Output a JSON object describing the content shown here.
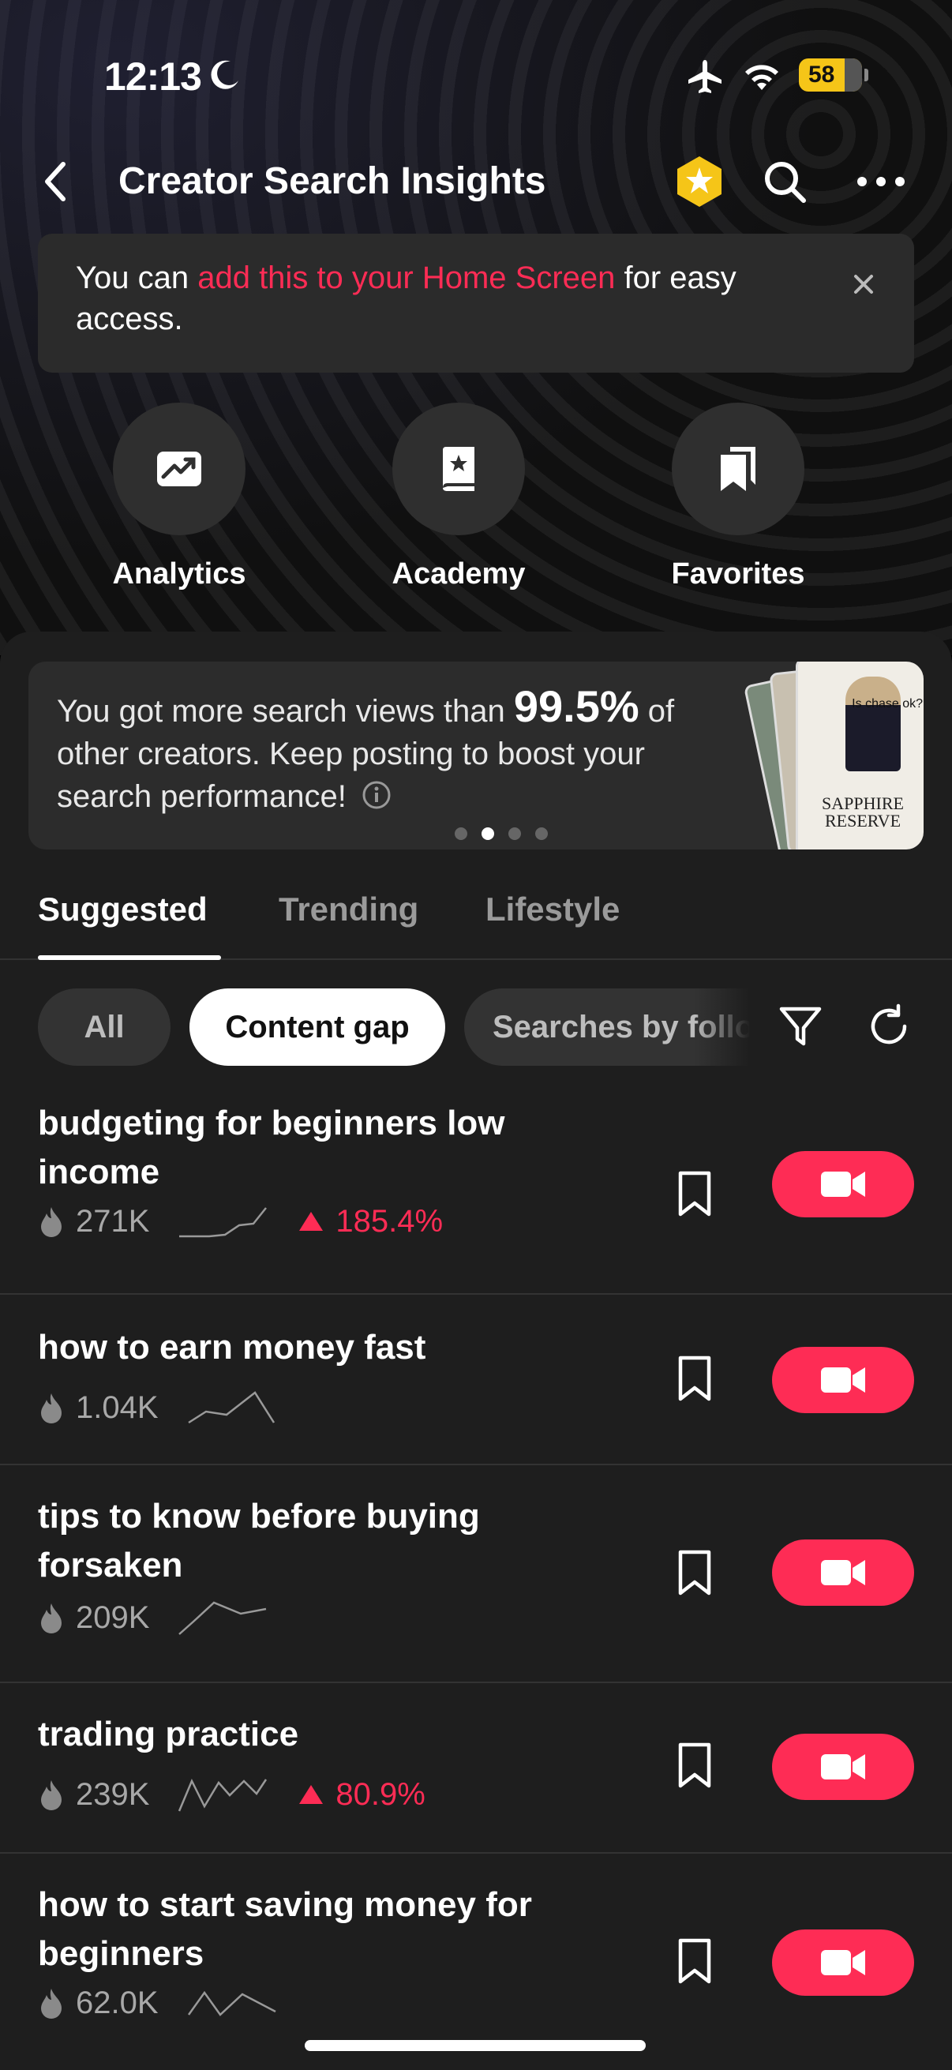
{
  "status_bar": {
    "time": "12:13",
    "battery": "58"
  },
  "header": {
    "title": "Creator Search Insights"
  },
  "banner": {
    "text_before": "You can ",
    "link_text": "add this to your Home Screen",
    "text_after": " for easy access."
  },
  "quick_actions": [
    {
      "label": "Analytics",
      "icon": "analytics-icon"
    },
    {
      "label": "Academy",
      "icon": "academy-icon"
    },
    {
      "label": "Favorites",
      "icon": "favorites-icon"
    }
  ],
  "insight": {
    "text_before": "You got more search views than ",
    "percent": "99.5%",
    "text_after": " of other creators. Keep posting to boost your search performance!",
    "carousel_total": 4,
    "carousel_active_index": 1,
    "card_caption": "SAPPHIRE RESERVE",
    "card_question": "Is chase ok?"
  },
  "tabs": [
    "Suggested",
    "Trending",
    "Lifestyle"
  ],
  "active_tab": "Suggested",
  "chips": [
    "All",
    "Content gap",
    "Searches by followers"
  ],
  "active_chip": "Content gap",
  "rows": [
    {
      "title": "budgeting for beginners low income",
      "views": "271K",
      "trend": "185.4%"
    },
    {
      "title": "how to earn money fast",
      "views": "1.04K",
      "trend": ""
    },
    {
      "title": "tips to know before buying forsaken",
      "views": "209K",
      "trend": ""
    },
    {
      "title": "trading practice",
      "views": "239K",
      "trend": "80.9%"
    },
    {
      "title": "how to start saving money for beginners",
      "views": "62.0K",
      "trend": ""
    }
  ],
  "colors": {
    "accent": "#fe2c55",
    "panel": "#1e1e1e",
    "chip": "#333333",
    "badge": "#f5c518"
  }
}
